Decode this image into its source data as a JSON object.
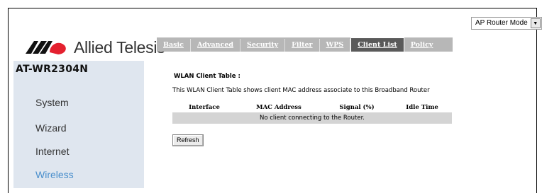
{
  "mode_select": {
    "value": "AP Router Mode",
    "icon": "chevron-down-icon"
  },
  "brand": {
    "name": "Allied Telesis",
    "colors": {
      "logo_dark": "#111111",
      "logo_red": "#e4212f"
    }
  },
  "nav": {
    "tabs": [
      {
        "label": "Basic",
        "active": false
      },
      {
        "label": "Advanced",
        "active": false
      },
      {
        "label": "Security",
        "active": false
      },
      {
        "label": "Filter",
        "active": false
      },
      {
        "label": "WPS",
        "active": false
      },
      {
        "label": "Client List",
        "active": true
      },
      {
        "label": "Policy",
        "active": false
      }
    ]
  },
  "sidebar": {
    "model": "AT-WR2304N",
    "items": [
      {
        "label": "System",
        "active": false
      },
      {
        "label": "Wizard",
        "active": false
      },
      {
        "label": "Internet",
        "active": false
      },
      {
        "label": "Wireless",
        "active": true
      }
    ]
  },
  "content": {
    "title": "WLAN Client Table :",
    "description": "This WLAN Client Table shows client MAC address associate to this Broadband Router",
    "table": {
      "headers": [
        "Interface",
        "MAC Address",
        "Signal (%)",
        "Idle Time"
      ],
      "empty_message": "No client connecting to the Router."
    },
    "refresh_label": "Refresh"
  }
}
